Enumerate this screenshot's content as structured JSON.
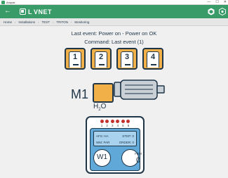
{
  "window": {
    "title": "Ampair",
    "controls": [
      "—",
      "☐",
      "✕"
    ]
  },
  "header": {
    "back_glyph": "←",
    "logo_text": "VNET",
    "logo_mark": "L",
    "icons": [
      "hexagon-icon",
      "gear-hexagon-icon"
    ]
  },
  "breadcrumb": [
    "Home",
    "Installations",
    "TEST",
    "TRITON",
    "Monitoring"
  ],
  "status": {
    "last_event": "Last event: Power on - Power on OK",
    "command": "Command: Last event (1)"
  },
  "slots": [
    {
      "label": "1"
    },
    {
      "label": "2"
    },
    {
      "label": "3"
    },
    {
      "label": "4"
    }
  ],
  "valve": {
    "name": "M1",
    "medium_main": "H",
    "medium_sub": "2",
    "medium_end": "O"
  },
  "panel": {
    "leds": [
      "1",
      "2",
      "3",
      "4",
      "5",
      "6"
    ],
    "afs": "AFS: HA",
    "step": "STEP: 0",
    "wm": "WM: PAR",
    "order": "ORDER: 0",
    "w_label": "W1",
    "frm_label": "FRM",
    "frm_value": "0"
  },
  "colors": {
    "header": "#399b68",
    "accent": "#f2b049",
    "ink": "#1f3548",
    "led": "#c4322e",
    "screen": "#5fa8d8"
  }
}
